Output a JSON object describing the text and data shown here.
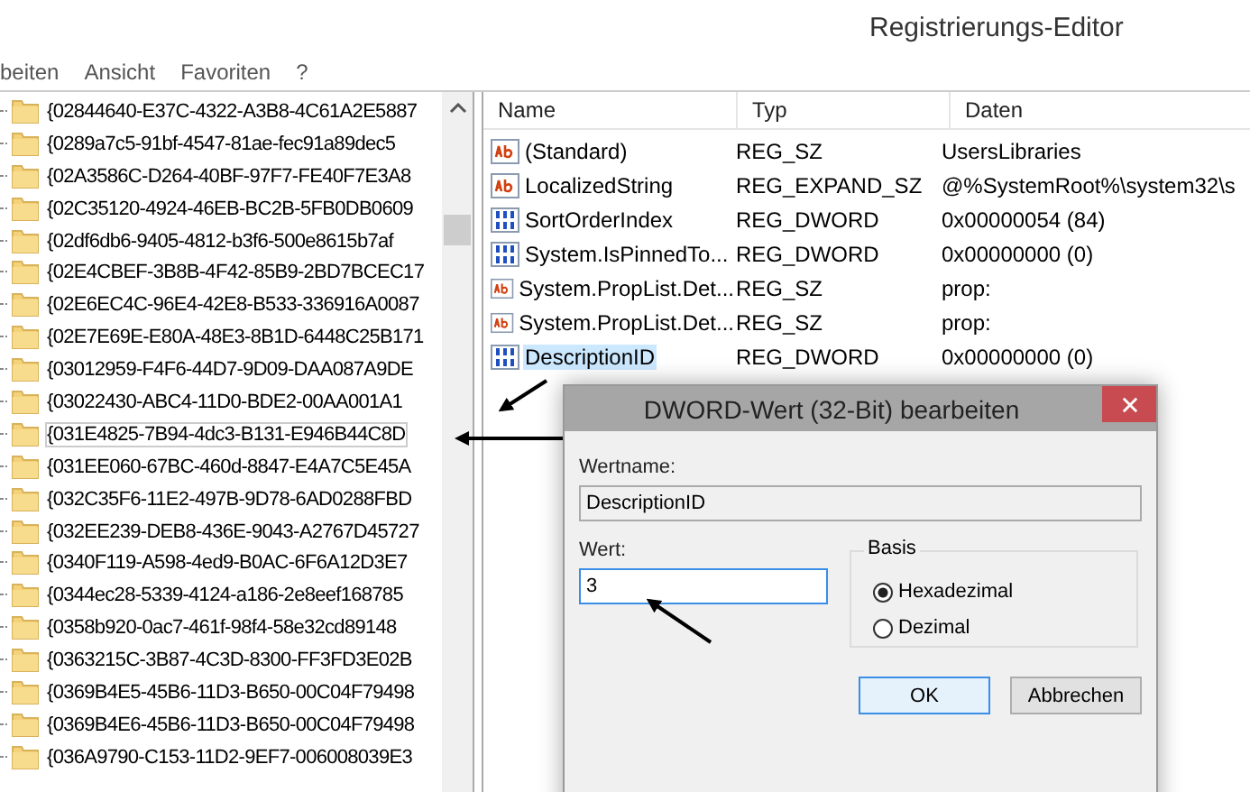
{
  "window": {
    "title": "Registrierungs-Editor"
  },
  "menu": [
    {
      "label": "beiten"
    },
    {
      "label": "Ansicht"
    },
    {
      "label": "Favoriten"
    },
    {
      "label": "?"
    }
  ],
  "tree": {
    "items": [
      {
        "label": "{02844640-E37C-4322-A3B8-4C61A2E5887",
        "selected": false
      },
      {
        "label": "{0289a7c5-91bf-4547-81ae-fec91a89dec5",
        "selected": false
      },
      {
        "label": "{02A3586C-D264-40BF-97F7-FE40F7E3A8",
        "selected": false
      },
      {
        "label": "{02C35120-4924-46EB-BC2B-5FB0DB0609",
        "selected": false
      },
      {
        "label": "{02df6db6-9405-4812-b3f6-500e8615b7af",
        "selected": false
      },
      {
        "label": "{02E4CBEF-3B8B-4F42-85B9-2BD7BCEC17",
        "selected": false
      },
      {
        "label": "{02E6EC4C-96E4-42E8-B533-336916A0087",
        "selected": false
      },
      {
        "label": "{02E7E69E-E80A-48E3-8B1D-6448C25B171",
        "selected": false
      },
      {
        "label": "{03012959-F4F6-44D7-9D09-DAA087A9DE",
        "selected": false
      },
      {
        "label": "{03022430-ABC4-11D0-BDE2-00AA001A1",
        "selected": false
      },
      {
        "label": "{031E4825-7B94-4dc3-B131-E946B44C8D",
        "selected": true
      },
      {
        "label": "{031EE060-67BC-460d-8847-E4A7C5E45A",
        "selected": false
      },
      {
        "label": "{032C35F6-11E2-497B-9D78-6AD0288FBD",
        "selected": false
      },
      {
        "label": "{032EE239-DEB8-436E-9043-A2767D45727",
        "selected": false
      },
      {
        "label": "{0340F119-A598-4ed9-B0AC-6F6A12D3E7",
        "selected": false
      },
      {
        "label": "{0344ec28-5339-4124-a186-2e8eef168785",
        "selected": false
      },
      {
        "label": "{0358b920-0ac7-461f-98f4-58e32cd89148",
        "selected": false
      },
      {
        "label": "{0363215C-3B87-4C3D-8300-FF3FD3E02B",
        "selected": false
      },
      {
        "label": "{0369B4E5-45B6-11D3-B650-00C04F79498",
        "selected": false
      },
      {
        "label": "{0369B4E6-45B6-11D3-B650-00C04F79498",
        "selected": false
      },
      {
        "label": "{036A9790-C153-11D2-9EF7-006008039E3",
        "selected": false
      }
    ]
  },
  "values": {
    "columns": [
      "Name",
      "Typ",
      "Daten"
    ],
    "rows": [
      {
        "kind": "string",
        "name": "(Standard)",
        "type": "REG_SZ",
        "data": "UsersLibraries",
        "selected": false
      },
      {
        "kind": "string",
        "name": "LocalizedString",
        "type": "REG_EXPAND_SZ",
        "data": "@%SystemRoot%\\system32\\s",
        "selected": false
      },
      {
        "kind": "dword",
        "name": "SortOrderIndex",
        "type": "REG_DWORD",
        "data": "0x00000054 (84)",
        "selected": false
      },
      {
        "kind": "dword",
        "name": "System.IsPinnedTo...",
        "type": "REG_DWORD",
        "data": "0x00000000 (0)",
        "selected": false
      },
      {
        "kind": "string",
        "name": "System.PropList.Det...",
        "type": "REG_SZ",
        "data": "prop:",
        "selected": false
      },
      {
        "kind": "string",
        "name": "System.PropList.Det...",
        "type": "REG_SZ",
        "data": "prop:",
        "selected": false
      },
      {
        "kind": "dword",
        "name": "DescriptionID",
        "type": "REG_DWORD",
        "data": "0x00000000 (0)",
        "selected": true
      }
    ]
  },
  "dialog": {
    "title": "DWORD-Wert (32-Bit) bearbeiten",
    "name_label": "Wertname:",
    "name_value": "DescriptionID",
    "value_label": "Wert:",
    "value": "3",
    "base_label": "Basis",
    "radios": [
      {
        "label": "Hexadezimal",
        "selected": true
      },
      {
        "label": "Dezimal",
        "selected": false
      }
    ],
    "buttons": [
      {
        "label": "OK",
        "default": true
      },
      {
        "label": "Abbrechen",
        "default": false
      }
    ]
  }
}
